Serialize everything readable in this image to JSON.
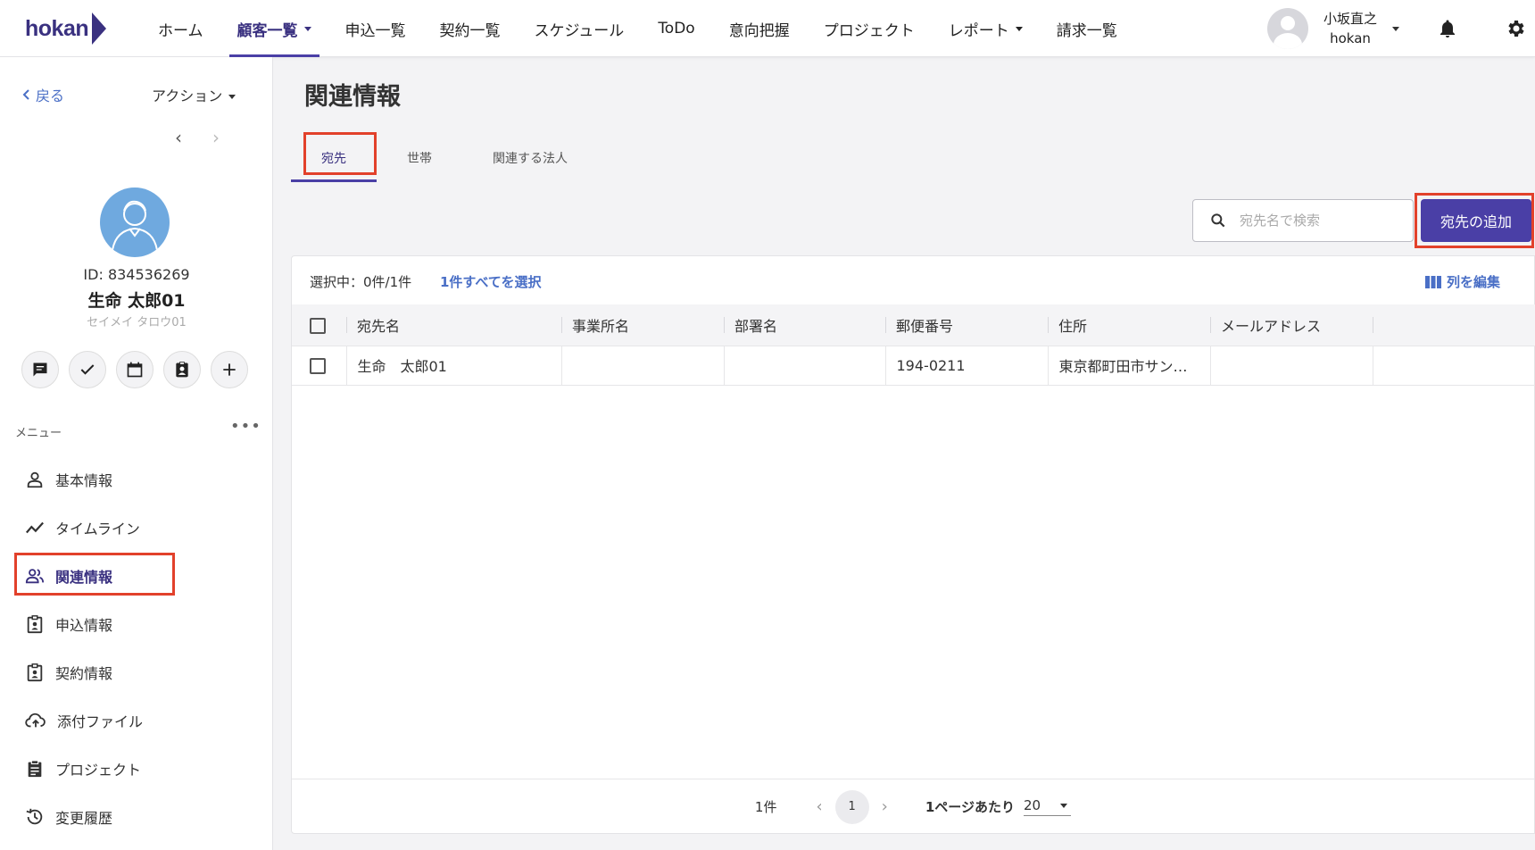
{
  "brand": {
    "logo_text": "hokan",
    "accent": "#4a3fa6",
    "link": "#4a6fc6",
    "highlight": "#e2412b"
  },
  "nav": {
    "items": [
      {
        "label": "ホーム"
      },
      {
        "label": "顧客一覧"
      },
      {
        "label": "申込一覧"
      },
      {
        "label": "契約一覧"
      },
      {
        "label": "スケジュール"
      },
      {
        "label": "ToDo"
      },
      {
        "label": "意向把握"
      },
      {
        "label": "プロジェクト"
      },
      {
        "label": "レポート"
      },
      {
        "label": "請求一覧"
      }
    ],
    "active": "顧客一覧",
    "icons": [
      "bell-icon",
      "gear-icon"
    ]
  },
  "user": {
    "name": "小坂直之",
    "org": "hokan"
  },
  "sidebar": {
    "back_label": "戻る",
    "action_label": "アクション",
    "customer": {
      "id": "ID: 834536269",
      "name": "生命 太郎01",
      "kana": "セイメイ タロウ01"
    },
    "quick_actions": [
      "message-icon",
      "check-icon",
      "calendar-icon",
      "contact-card-icon",
      "plus-icon"
    ],
    "menu_label": "メニュー",
    "menu": [
      {
        "label": "基本情報",
        "icon": "person-icon"
      },
      {
        "label": "タイムライン",
        "icon": "timeline-icon"
      },
      {
        "label": "関連情報",
        "icon": "people-icon",
        "active": true
      },
      {
        "label": "申込情報",
        "icon": "badge-icon"
      },
      {
        "label": "契約情報",
        "icon": "badge-icon"
      },
      {
        "label": "添付ファイル",
        "icon": "cloud-upload-icon"
      },
      {
        "label": "プロジェクト",
        "icon": "clipboard-icon"
      },
      {
        "label": "変更履歴",
        "icon": "history-icon"
      }
    ]
  },
  "main": {
    "title": "関連情報",
    "tabs": [
      {
        "label": "宛先"
      },
      {
        "label": "世帯"
      },
      {
        "label": "関連する法人"
      }
    ],
    "search": {
      "placeholder": "宛先名で検索"
    },
    "add_button": "宛先の追加",
    "selection": "選択中：0件/1件",
    "select_all": "1件すべてを選択",
    "edit_columns": "列を編集",
    "table": {
      "columns": [
        "宛先名",
        "事業所名",
        "部署名",
        "郵便番号",
        "住所",
        "メールアドレス"
      ],
      "rows": [
        [
          "生命　太郎01",
          "",
          "",
          "194-0211",
          "東京都町田市サン…",
          ""
        ]
      ]
    },
    "pagination": {
      "count": "1件",
      "page": "1",
      "per_page_label": "1ページあたり",
      "per_page": "20"
    }
  }
}
